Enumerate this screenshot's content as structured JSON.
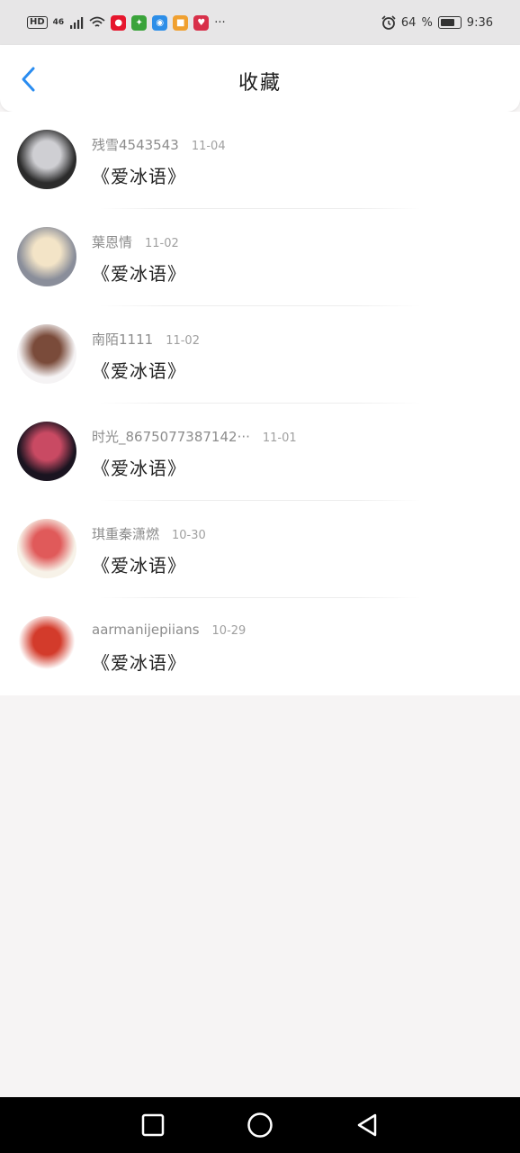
{
  "status_bar": {
    "hd": "HD",
    "signal": "46",
    "more": "···",
    "battery": "64",
    "time": "9:36"
  },
  "header": {
    "title": "收藏",
    "accent": "#2a8cf0"
  },
  "items": [
    {
      "author": "残雪4543543",
      "date": "11-04",
      "title": "《爱冰语》",
      "avatar_colors": [
        "#2b2b2b",
        "#cfcfd3"
      ]
    },
    {
      "author": "葉恩情",
      "date": "11-02",
      "title": "《爱冰语》",
      "avatar_colors": [
        "#8a8e9a",
        "#f3e4c7"
      ]
    },
    {
      "author": "南陌1111",
      "date": "11-02",
      "title": "《爱冰语》",
      "avatar_colors": [
        "#f5f3f4",
        "#7a4b3a"
      ]
    },
    {
      "author": "时光_8675077387142···",
      "date": "11-01",
      "title": "《爱冰语》",
      "avatar_colors": [
        "#1a1420",
        "#c94a63"
      ]
    },
    {
      "author": "琪重秦潇燃",
      "date": "10-30",
      "title": "《爱冰语》",
      "avatar_colors": [
        "#f7f2e8",
        "#e05a5a"
      ]
    },
    {
      "author": "aarmanijepiians",
      "date": "10-29",
      "title": "《爱冰语》",
      "avatar_colors": [
        "#ffffff",
        "#d33b2b"
      ]
    }
  ]
}
